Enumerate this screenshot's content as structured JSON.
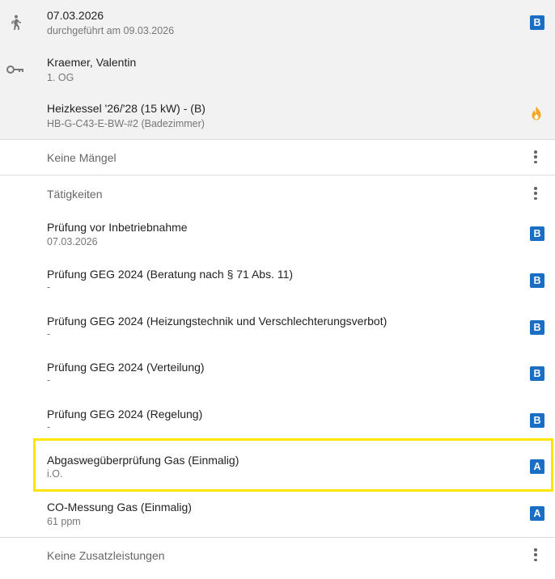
{
  "header": {
    "date_row": {
      "title": "07.03.2026",
      "subtitle": "durchgeführt am 09.03.2026",
      "icon": "walking-person-icon",
      "badge": "B"
    },
    "customer_row": {
      "title": "Kraemer, Valentin",
      "subtitle": "1. OG",
      "icon": "key-icon"
    },
    "device_row": {
      "title": "Heizkessel '26/'28 (15 kW) - (B)",
      "subtitle": "HB-G-C43-E-BW-#2 (Badezimmer)",
      "icon": "flame-icon"
    }
  },
  "defects": {
    "label": "Keine Mängel"
  },
  "activities": {
    "label": "Tätigkeiten",
    "items": [
      {
        "title": "Prüfung vor Inbetriebnahme",
        "subtitle": "07.03.2026",
        "badge": "B"
      },
      {
        "title": "Prüfung GEG 2024 (Beratung nach § 71 Abs. 11)",
        "subtitle": "-",
        "badge": "B"
      },
      {
        "title": "Prüfung GEG 2024 (Heizungstechnik und Verschlechterungsverbot)",
        "subtitle": "-",
        "badge": "B"
      },
      {
        "title": "Prüfung GEG 2024 (Verteilung)",
        "subtitle": "-",
        "badge": "B"
      },
      {
        "title": "Prüfung GEG 2024 (Regelung)",
        "subtitle": "-",
        "badge": "B"
      },
      {
        "title": "Abgaswegüberprüfung Gas (Einmalig)",
        "subtitle": "i.O.",
        "badge": "A",
        "highlighted": true
      },
      {
        "title": "CO-Messung Gas (Einmalig)",
        "subtitle": "61 ppm",
        "badge": "A"
      }
    ]
  },
  "extras": {
    "label": "Keine Zusatzleistungen"
  },
  "colors": {
    "badge": "#1a6fc4",
    "highlight": "#ffe500",
    "flame": "#f5a623",
    "header_bg": "#f2f2f2"
  }
}
